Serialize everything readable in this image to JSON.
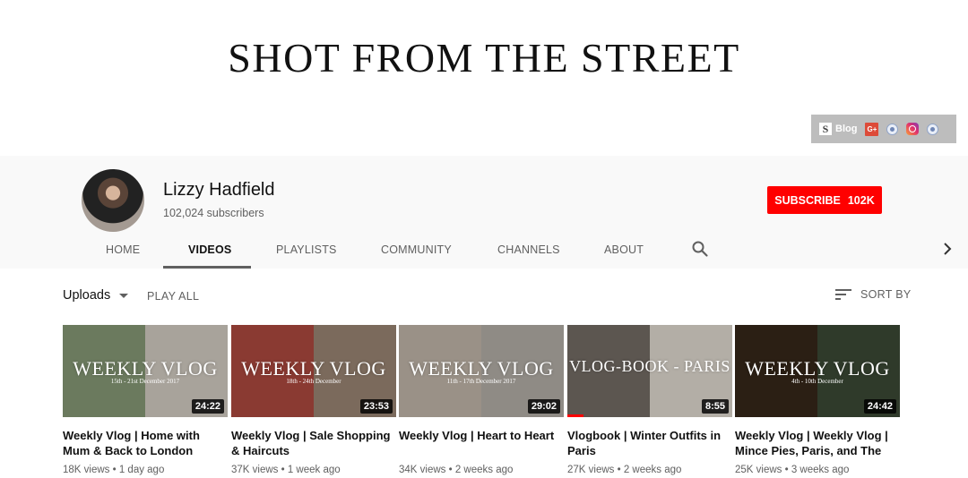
{
  "banner": {
    "title": "SHOT FROM THE STREET",
    "links": {
      "blog_label": "Blog",
      "gplus_label": "G+",
      "blog_mark": "S"
    }
  },
  "channel": {
    "name": "Lizzy Hadfield",
    "subscribers": "102,024 subscribers",
    "subscribe_label": "SUBSCRIBE",
    "subscribe_count": "102K"
  },
  "tabs": [
    {
      "label": "HOME"
    },
    {
      "label": "VIDEOS"
    },
    {
      "label": "PLAYLISTS"
    },
    {
      "label": "COMMUNITY"
    },
    {
      "label": "CHANNELS"
    },
    {
      "label": "ABOUT"
    }
  ],
  "active_tab": "VIDEOS",
  "uploads": {
    "label": "Uploads",
    "play_all": "PLAY ALL",
    "sort_by": "SORT BY"
  },
  "colors": {
    "brand_red": "#ff0000",
    "header_bg": "#f9f9f9",
    "meta_gray": "#606060"
  },
  "videos": [
    {
      "overlay_title": "WEEKLY VLOG",
      "overlay_sub": "15th - 21st December 2017",
      "duration": "24:22",
      "title": "Weekly Vlog | Home with Mum & Back to London",
      "meta": "18K views • 1 day ago",
      "thumb_colors": [
        "#6b7a5e",
        "#a8a39b"
      ],
      "progress": 0
    },
    {
      "overlay_title": "WEEKLY VLOG",
      "overlay_sub": "18th - 24th December",
      "duration": "23:53",
      "title": "Weekly Vlog | Sale Shopping & Haircuts",
      "meta": "37K views • 1 week ago",
      "thumb_colors": [
        "#8a3a32",
        "#7b6a5c"
      ],
      "progress": 0
    },
    {
      "overlay_title": "WEEKLY VLOG",
      "overlay_sub": "11th - 17th December 2017",
      "duration": "29:02",
      "title": "Weekly Vlog | Heart to Heart",
      "meta": "34K views • 2 weeks ago",
      "thumb_colors": [
        "#9a9187",
        "#8f8b85"
      ],
      "progress": 0
    },
    {
      "overlay_title": "VLOG-BOOK - PARIS",
      "overlay_sub": "",
      "duration": "8:55",
      "title": "Vlogbook | Winter Outfits in Paris",
      "meta": "27K views • 2 weeks ago",
      "thumb_colors": [
        "#5c5650",
        "#b3aea6"
      ],
      "progress": 0.1
    },
    {
      "overlay_title": "WEEKLY VLOG",
      "overlay_sub": "4th - 10th December",
      "duration": "24:42",
      "title": "Weekly Vlog | Weekly Vlog | Mince Pies, Paris, and The",
      "meta": "25K views • 3 weeks ago",
      "thumb_colors": [
        "#2b1f14",
        "#2f3a2a"
      ],
      "progress": 0
    }
  ]
}
